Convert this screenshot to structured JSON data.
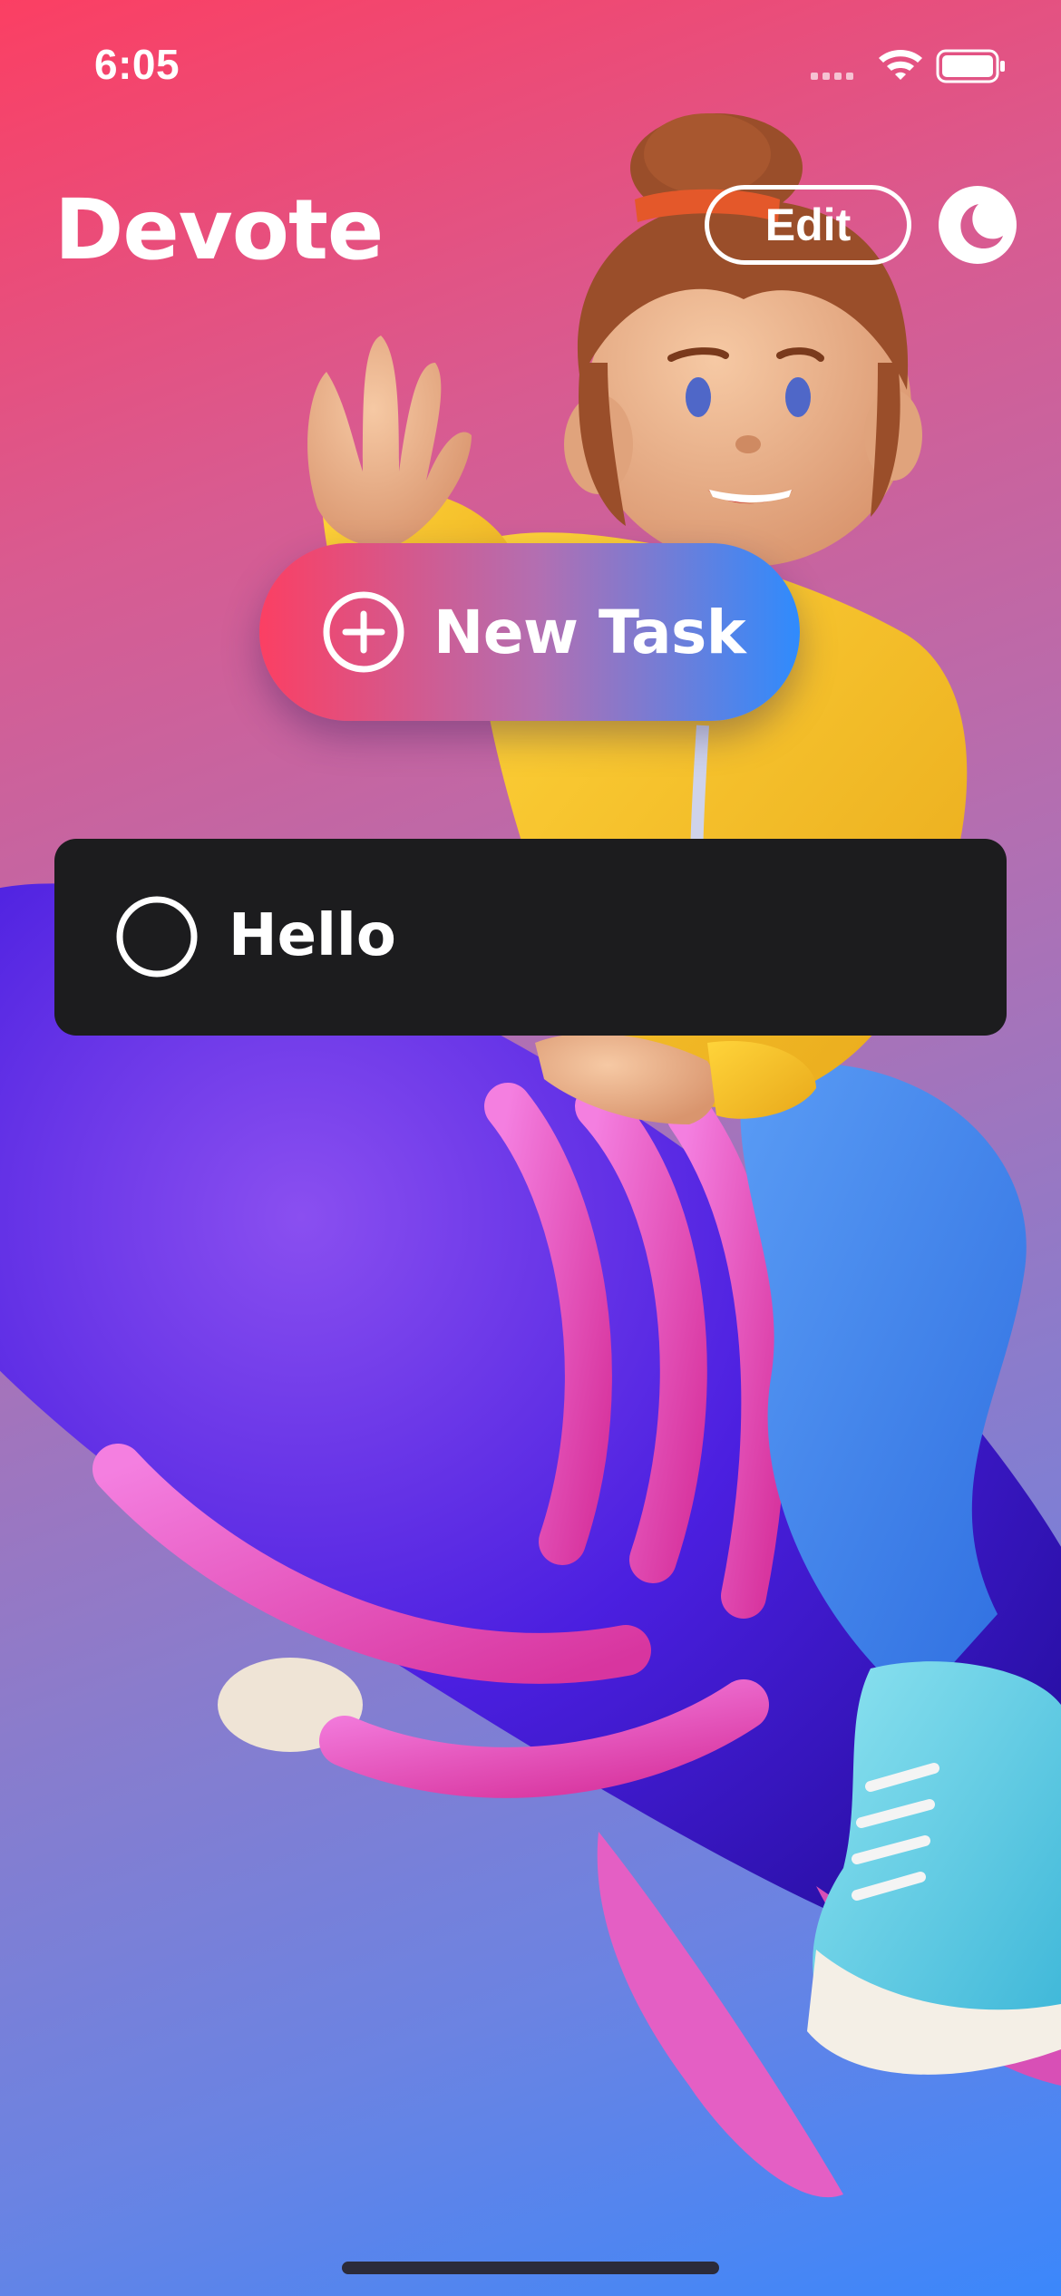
{
  "status_bar": {
    "time": "6:05",
    "icons": [
      "signal-icon",
      "wifi-icon",
      "battery-icon"
    ]
  },
  "header": {
    "title": "Devote",
    "edit_label": "Edit",
    "theme_icon": "moon-icon"
  },
  "actions": {
    "new_task_label": "New Task",
    "new_task_icon": "plus-circle-icon"
  },
  "tasks": [
    {
      "title": "Hello",
      "completed": false
    }
  ],
  "colors": {
    "gradient_start": "#fb3f63",
    "gradient_mid": "#b26fb2",
    "gradient_end": "#3b87fb",
    "task_row_bg": "#1c1c1e",
    "text": "#ffffff"
  }
}
